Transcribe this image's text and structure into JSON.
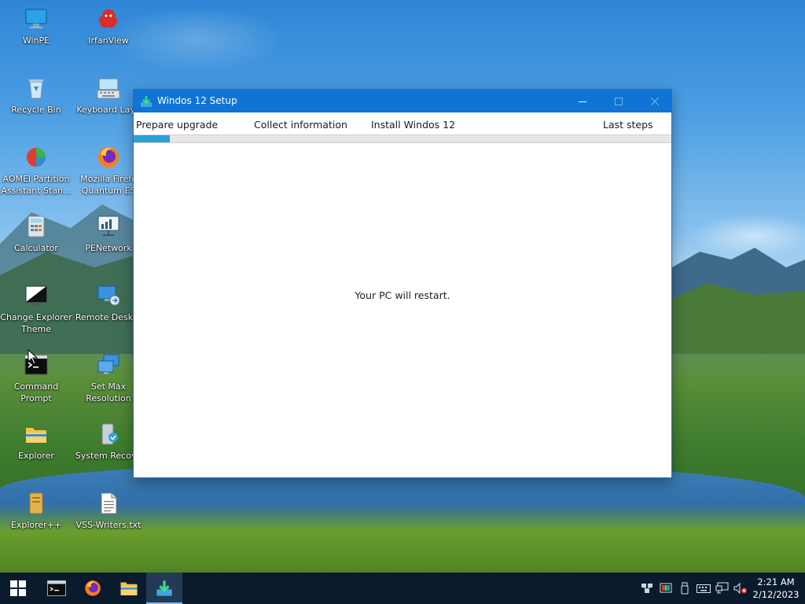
{
  "desktop_icons": [
    {
      "label": "WinPE",
      "icon": "monitor-icon"
    },
    {
      "label": "IrfanView",
      "icon": "irfanview-icon"
    },
    {
      "label": "Recycle Bin",
      "icon": "recycle-bin-icon"
    },
    {
      "label": "Keyboard Layo",
      "icon": "keyboard-icon"
    },
    {
      "label": "AOMEI Partition\nAssistant Stan...",
      "icon": "aomei-icon"
    },
    {
      "label": "Mozilla Firefo\nQuantum ES",
      "icon": "firefox-icon"
    },
    {
      "label": "Calculator",
      "icon": "calculator-icon"
    },
    {
      "label": "PENetwork",
      "icon": "network-icon"
    },
    {
      "label": "Change Explorer\nTheme",
      "icon": "theme-icon"
    },
    {
      "label": "Remote Deskto",
      "icon": "remote-desktop-icon"
    },
    {
      "label": "Command\nPrompt",
      "icon": "terminal-icon"
    },
    {
      "label": "Set Max\nResolution",
      "icon": "resolution-icon"
    },
    {
      "label": "Explorer",
      "icon": "folder-icon"
    },
    {
      "label": "System Recove",
      "icon": "system-recovery-icon"
    },
    {
      "label": "Explorer++",
      "icon": "explorerpp-icon"
    },
    {
      "label": "VSS-Writers.txt",
      "icon": "text-file-icon"
    }
  ],
  "window": {
    "title": "Windos 12 Setup",
    "steps": [
      "Prepare upgrade",
      "Collect information",
      "Install Windos 12",
      "Last steps"
    ],
    "progress_fraction": 0.067,
    "message": "Your PC will restart."
  },
  "taskbar": {
    "items": [
      "start-icon",
      "terminal-icon",
      "firefox-icon",
      "folder-icon",
      "setup-icon"
    ],
    "active_item": "setup-icon",
    "tray_icons": [
      "network-icon",
      "color-icon",
      "usb-icon",
      "keyboard-icon",
      "network-monitor-icon",
      "volume-muted-icon"
    ],
    "clock": {
      "time": "2:21 AM",
      "date": "2/12/2023"
    }
  },
  "colors": {
    "titlebar": "#0f74d5",
    "progress": "#2a9fd8",
    "taskbar": "#0b1b2e"
  }
}
